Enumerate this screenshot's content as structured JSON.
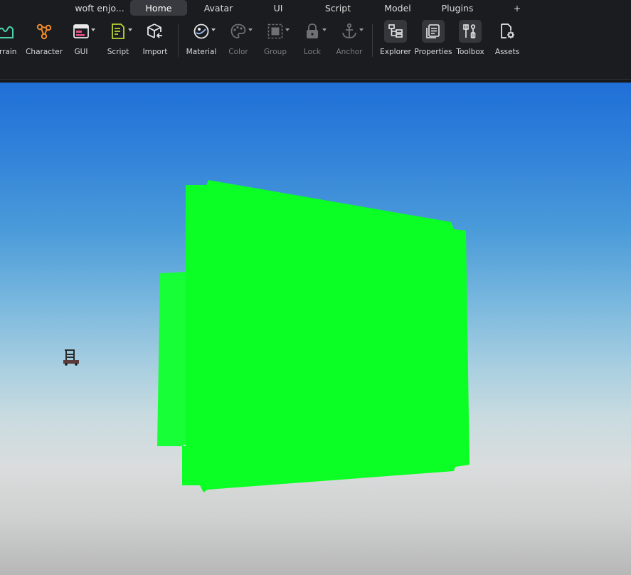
{
  "menu": {
    "tabs": [
      {
        "label": "woft enjo..."
      },
      {
        "label": "Home"
      },
      {
        "label": "Avatar"
      },
      {
        "label": "UI"
      },
      {
        "label": "Script"
      },
      {
        "label": "Model"
      },
      {
        "label": "Plugins"
      },
      {
        "label": "+"
      }
    ],
    "active_tab": "Home"
  },
  "ribbon": {
    "terrain": "errain",
    "character": "Character",
    "gui": "GUI",
    "script": "Script",
    "import": "Import",
    "material": "Material",
    "color": "Color",
    "group": "Group",
    "lock": "Lock",
    "anchor": "Anchor",
    "explorer": "Explorer",
    "properties": "Properties",
    "toolbox": "Toolbox",
    "assets": "Assets"
  },
  "colors": {
    "part_green": "#0bff24",
    "part_green_side": "#17ff36",
    "ribbon_bg": "#1b1c1f",
    "accent_orange": "#f08a2c",
    "accent_pink": "#e8508a",
    "accent_lime": "#b7d433"
  },
  "icons": [
    "terrain-icon",
    "character-icon",
    "gui-icon",
    "script-icon",
    "import-icon",
    "material-icon",
    "color-icon",
    "group-icon",
    "lock-icon",
    "anchor-icon",
    "explorer-icon",
    "properties-icon",
    "toolbox-icon",
    "assets-icon"
  ]
}
